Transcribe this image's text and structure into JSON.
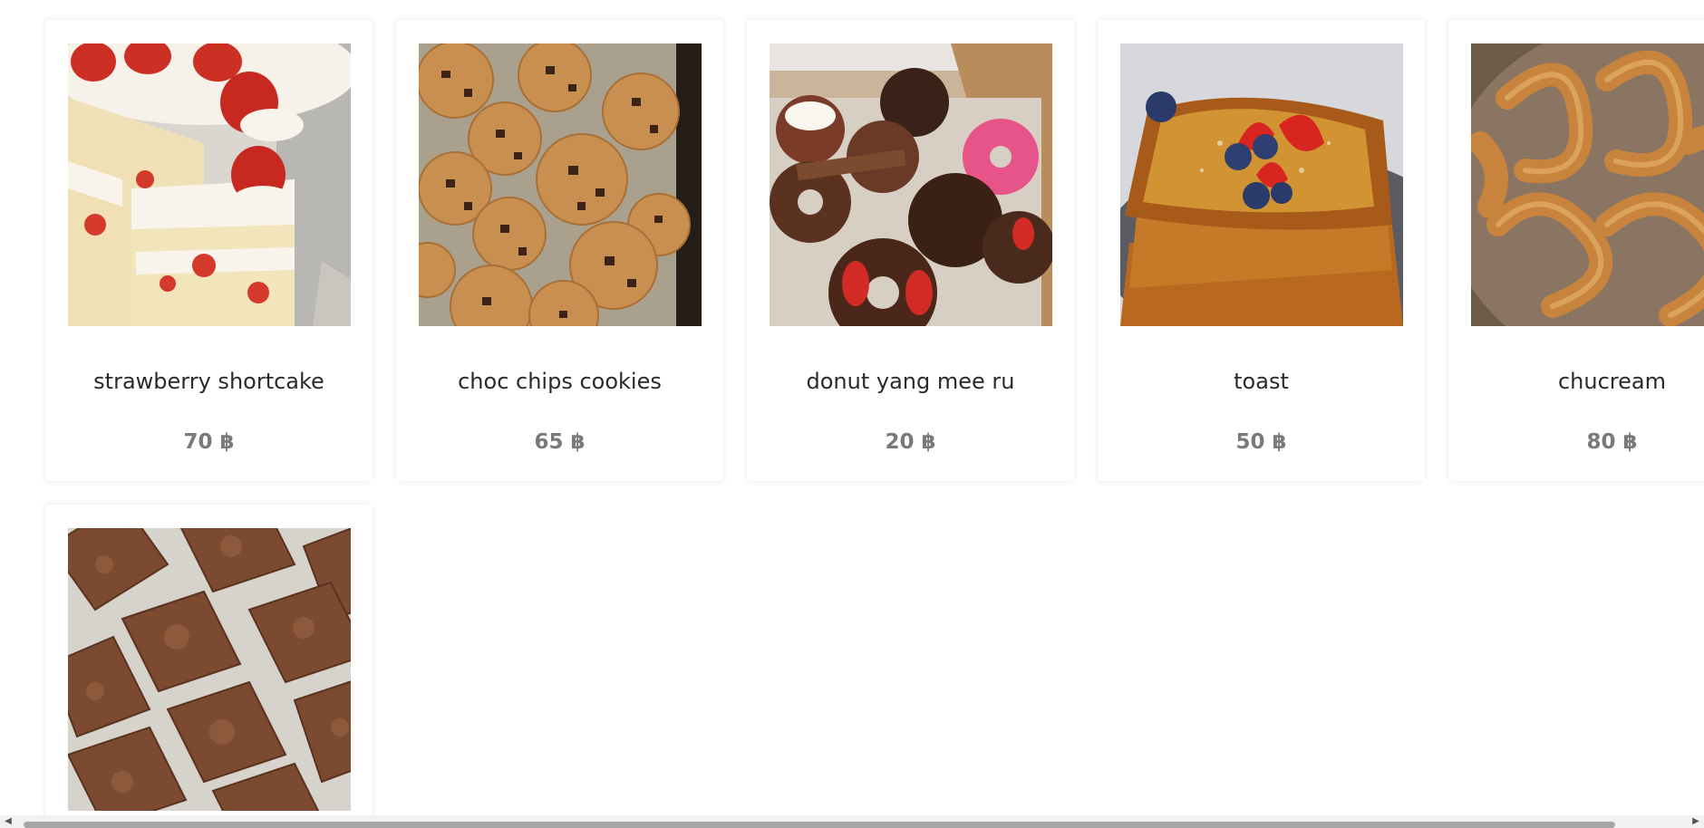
{
  "products": [
    {
      "name": "strawberry shortcake",
      "price": "70 ฿",
      "image": "strawberry-shortcake-photo"
    },
    {
      "name": "choc chips cookies",
      "price": "65 ฿",
      "image": "chocolate-chip-cookies-photo"
    },
    {
      "name": "donut yang mee ru",
      "price": "20 ฿",
      "image": "donuts-box-photo"
    },
    {
      "name": "toast",
      "price": "50 ฿",
      "image": "french-toast-photo"
    },
    {
      "name": "chucream",
      "price": "80 ฿",
      "image": "churros-photo"
    },
    {
      "name": "",
      "price": "",
      "image": "brownies-photo"
    }
  ],
  "colors": {
    "card_bg": "#ffffff",
    "name_text": "#2a2a2a",
    "price_text": "#7a7a7a",
    "scroll_thumb": "#a6a6a6"
  }
}
